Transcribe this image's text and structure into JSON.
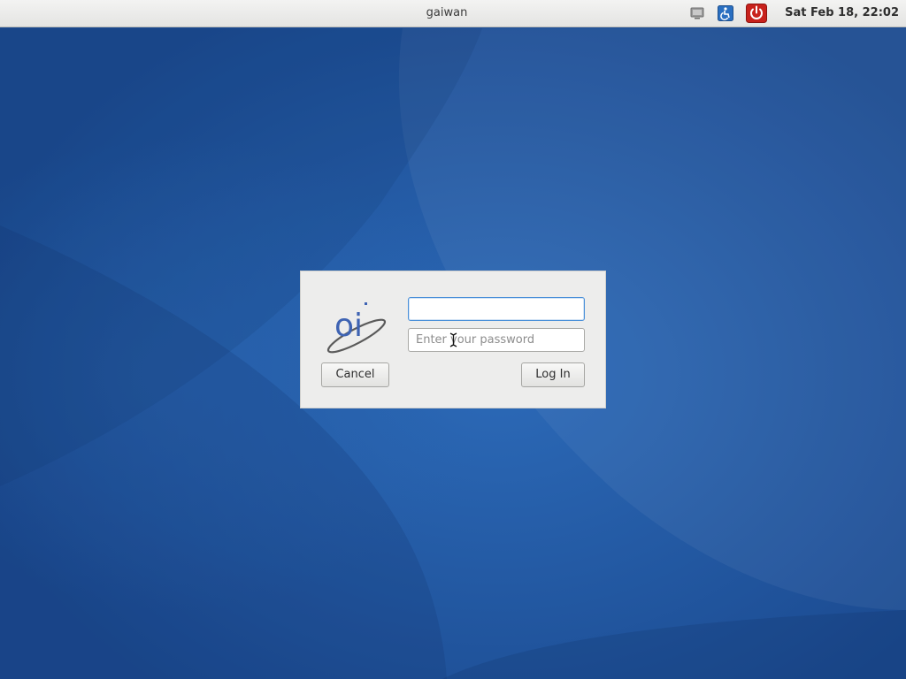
{
  "top_panel": {
    "hostname": "gaiwan",
    "clock": "Sat Feb 18, 22:02",
    "tray_icons": [
      "display-icon",
      "accessibility-icon",
      "power-icon"
    ]
  },
  "login_dialog": {
    "logo_text": "oi",
    "username": {
      "value": "",
      "placeholder": ""
    },
    "password": {
      "value": "",
      "placeholder": "Enter your password"
    },
    "cancel_label": "Cancel",
    "login_label": "Log In"
  },
  "colors": {
    "wallpaper_base": "#1c4d95",
    "panel_bg": "#ebebea",
    "dialog_bg": "#ededec",
    "focus_border": "#4a90d9",
    "power_red": "#c8221c",
    "logo_blue": "#3e63b3"
  }
}
